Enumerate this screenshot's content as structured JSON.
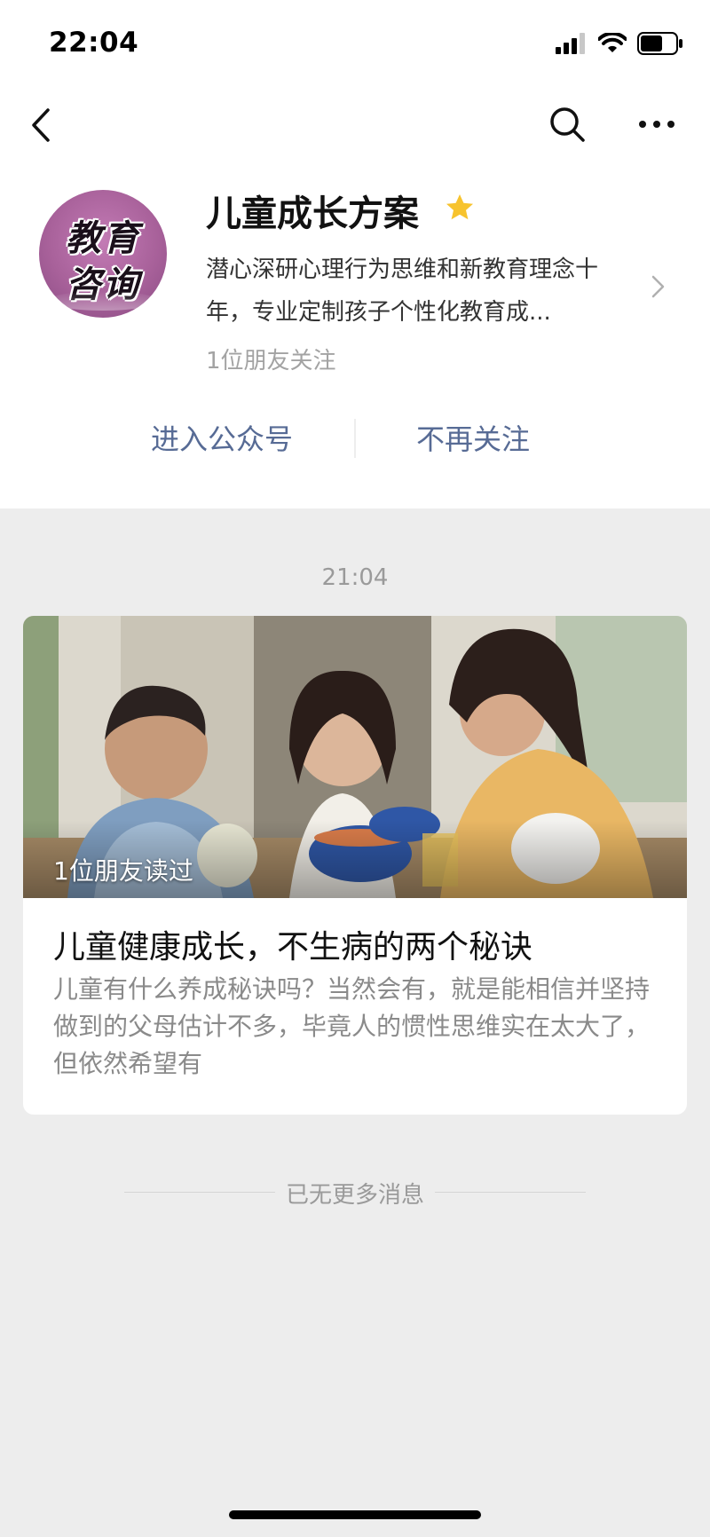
{
  "status_bar": {
    "time": "22:04",
    "icons": [
      "signal-icon",
      "wifi-icon",
      "battery-icon"
    ]
  },
  "nav": {
    "back_icon": "chevron-left-icon",
    "search_icon": "search-icon",
    "more_icon": "more-icon"
  },
  "account": {
    "avatar_text_line1": "教育",
    "avatar_text_line2": "咨询",
    "name": "儿童成长方案",
    "starred_icon": "star-icon",
    "description": "潜心深研心理行为思维和新教育理念十年，专业定制孩子个性化教育成...",
    "followers_text": "1位朋友关注"
  },
  "actions": {
    "enter_label": "进入公众号",
    "unfollow_label": "不再关注"
  },
  "feed": {
    "timestamp": "21:04",
    "article": {
      "image_caption": "1位朋友读过",
      "title": "儿童健康成长，不生病的两个秘诀",
      "digest": "儿童有什么养成秘诀吗？当然会有，就是能相信并坚持做到的父母估计不多，毕竟人的惯性思维实在太大了，但依然希望有"
    },
    "end_text": "已无更多消息"
  },
  "colors": {
    "link_blue": "#576b95",
    "star_gold": "#f7c32e",
    "page_bg": "#ededed"
  }
}
